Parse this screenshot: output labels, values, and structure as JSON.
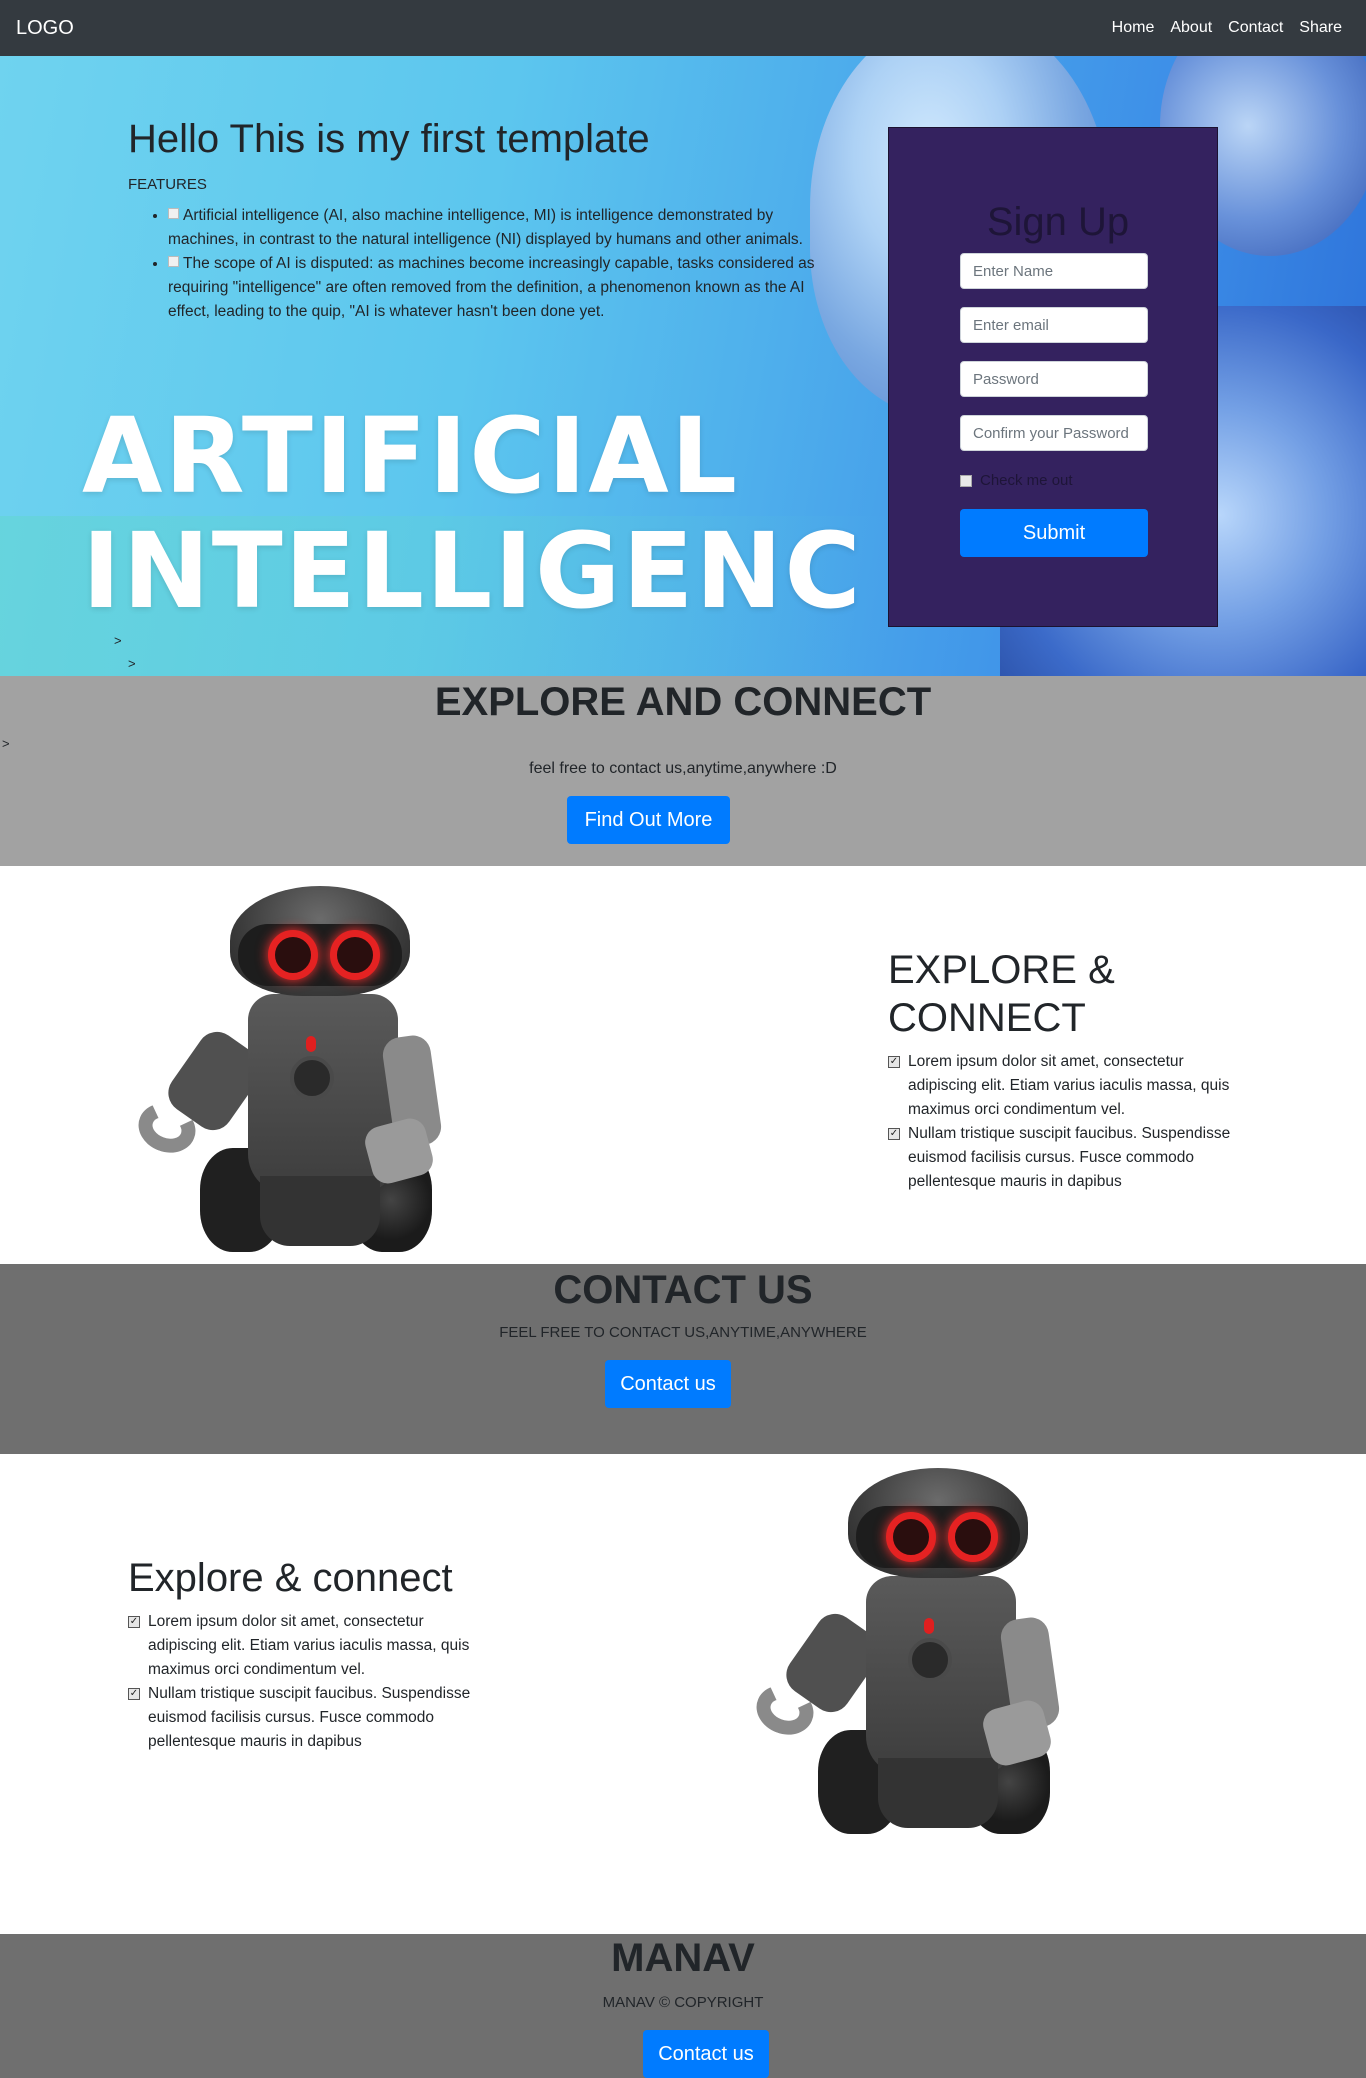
{
  "navbar": {
    "logo": "LOGO",
    "links": [
      "Home",
      "About",
      "Contact",
      "Share"
    ]
  },
  "hero": {
    "title": "Hello This is my first template",
    "features_label": "FEATURES",
    "features": [
      "Artificial intelligence (AI, also machine intelligence, MI) is intelligence demonstrated by machines, in contrast to the natural intelligence (NI) displayed by humans and other animals.",
      "The scope of AI is disputed: as machines become increasingly capable, tasks considered as requiring \"intelligence\" are often removed from the definition, a phenomenon known as the AI effect, leading to the quip, \"AI is whatever hasn't been done yet."
    ],
    "banner_line1": "ARTIFICIAL",
    "banner_line2": "INTELLIGENC",
    "stray_1": ">",
    "stray_2": ">"
  },
  "signup": {
    "title": "Sign Up",
    "name_placeholder": "Enter Name",
    "email_placeholder": "Enter email",
    "password_placeholder": "Password",
    "confirm_placeholder": "Confirm your Password",
    "check_label": "Check me out",
    "submit_label": "Submit"
  },
  "explore_band": {
    "title": "EXPLORE AND CONNECT",
    "stray": ">",
    "subtitle": "feel free to contact us,anytime,anywhere :D",
    "button": "Find Out More"
  },
  "feature_one": {
    "title": "EXPLORE & CONNECT",
    "items": [
      "Lorem ipsum dolor sit amet, consectetur adipiscing elit. Etiam varius iaculis massa, quis maximus orci condimentum vel.",
      "Nullam tristique suscipit faucibus. Suspendisse euismod facilisis cursus. Fusce commodo pellentesque mauris in dapibus"
    ]
  },
  "contact_band": {
    "title": "CONTACT US",
    "subtitle": "FEEL FREE TO CONTACT US,ANYTIME,ANYWHERE",
    "button": "Contact us"
  },
  "feature_two": {
    "title": "Explore & connect",
    "items": [
      "Lorem ipsum dolor sit amet, consectetur adipiscing elit. Etiam varius iaculis massa, quis maximus orci condimentum vel.",
      "Nullam tristique suscipit faucibus. Suspendisse euismod facilisis cursus. Fusce commodo pellentesque mauris in dapibus"
    ]
  },
  "footer": {
    "title": "MANAV",
    "copyright": "MANAV © COPYRIGHT",
    "button": "Contact us"
  },
  "colors": {
    "navbar": "#343a40",
    "primary_button": "#007bff",
    "signup_panel": "#34225f",
    "explore_band": "#a2a2a2",
    "contact_band": "#6f6f6f"
  }
}
